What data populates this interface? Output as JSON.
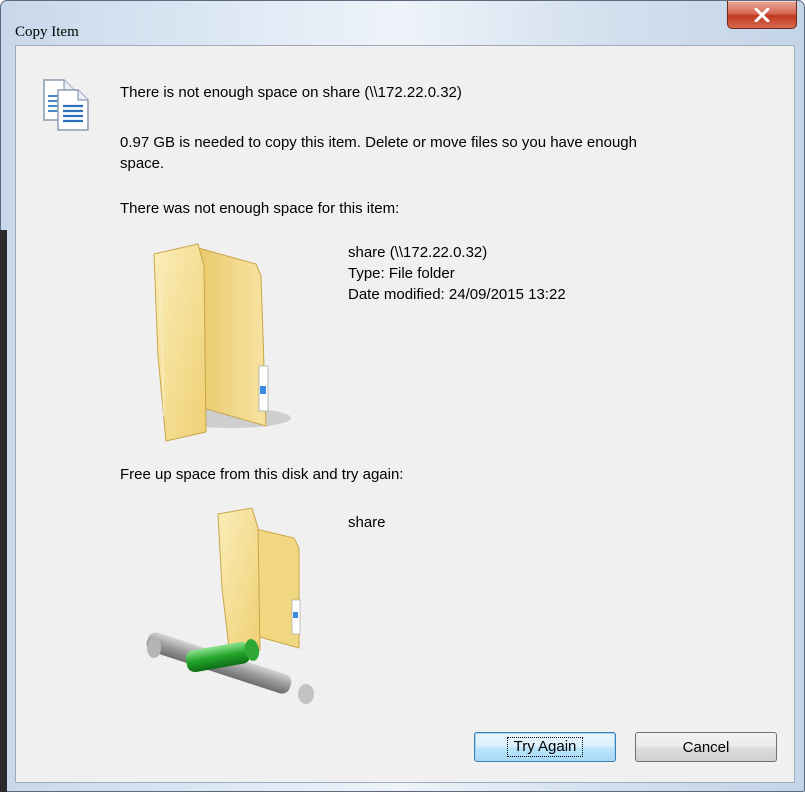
{
  "window": {
    "title": "Copy Item",
    "close_icon": "close-icon"
  },
  "message": {
    "heading": "There is not enough space on share (\\\\172.22.0.32)",
    "detail_line1": "0.97 GB is needed to copy this item. Delete or move files so you have enough",
    "detail_line2": "space.",
    "item_section_label": "There was not enough space for this item:"
  },
  "item": {
    "icon": "folder-icon",
    "name": "share (\\\\172.22.0.32)",
    "type": "Type: File folder",
    "date_modified": "Date modified: 24/09/2015 13:22"
  },
  "disk": {
    "section_label": "Free up space from this disk and try again:",
    "icon": "network-folder-icon",
    "name": "share"
  },
  "buttons": {
    "try_again": "Try Again",
    "cancel": "Cancel"
  },
  "colors": {
    "close_button": "#c7452c",
    "dialog_body": "#f0f0f0",
    "folder": "#f2d27a",
    "network_pipe": "#2eb03a"
  }
}
